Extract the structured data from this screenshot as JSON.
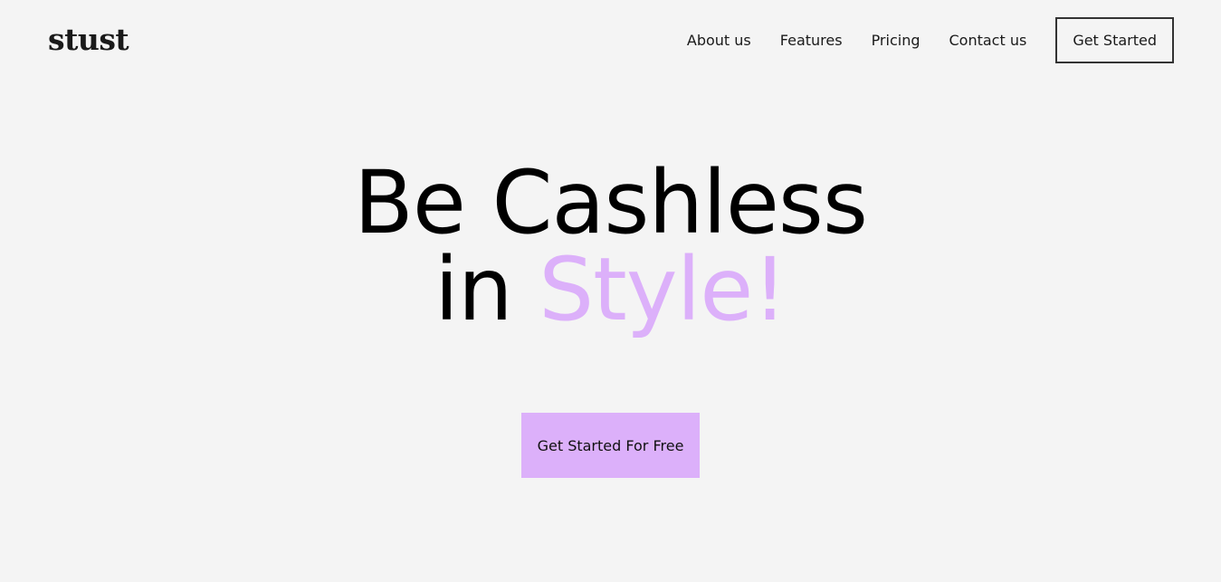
{
  "brand": {
    "logo_text": "stust"
  },
  "nav": {
    "links": [
      {
        "label": "About us"
      },
      {
        "label": "Features"
      },
      {
        "label": "Pricing"
      },
      {
        "label": "Contact us"
      }
    ],
    "cta_label": "Get Started"
  },
  "hero": {
    "line1": "Be Cashless",
    "line2_prefix": "in ",
    "line2_accent": "Style!",
    "cta_label": "Get Started For Free"
  },
  "colors": {
    "background": "#f4f4f4",
    "accent": "#dcb0fa",
    "text": "#000000",
    "nav_border": "#333333"
  }
}
